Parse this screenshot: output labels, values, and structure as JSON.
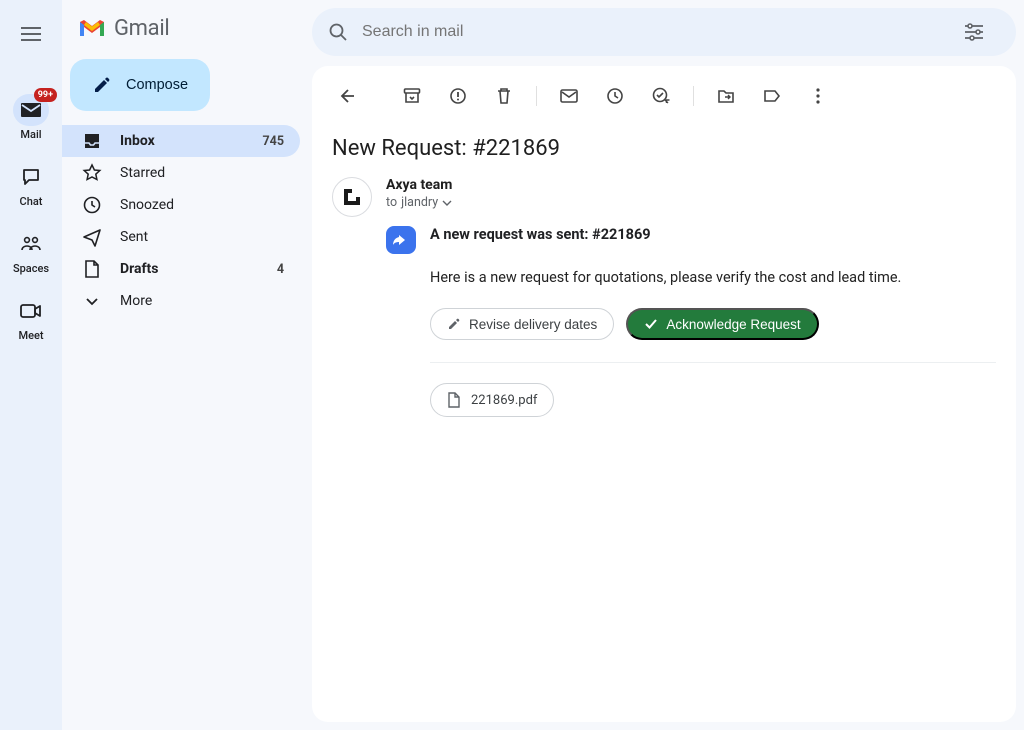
{
  "rail": {
    "badge": "99+",
    "items": [
      {
        "label": "Mail"
      },
      {
        "label": "Chat"
      },
      {
        "label": "Spaces"
      },
      {
        "label": "Meet"
      }
    ]
  },
  "brand": "Gmail",
  "compose_label": "Compose",
  "sidebar": {
    "items": [
      {
        "label": "Inbox",
        "count": "745"
      },
      {
        "label": "Starred"
      },
      {
        "label": "Snoozed"
      },
      {
        "label": "Sent"
      },
      {
        "label": "Drafts",
        "count": "4"
      },
      {
        "label": "More"
      }
    ]
  },
  "search": {
    "placeholder": "Search in mail"
  },
  "email": {
    "subject": "New Request: #221869",
    "sender": "Axya team",
    "to_prefix": "to",
    "recipient": "jlandry",
    "headline": "A new request was sent: #221869",
    "body": "Here is a new request for quotations, please verify the cost and lead time.",
    "actions": {
      "revise": "Revise delivery dates",
      "acknowledge": "Acknowledge Request"
    },
    "attachment": "221869.pdf"
  }
}
